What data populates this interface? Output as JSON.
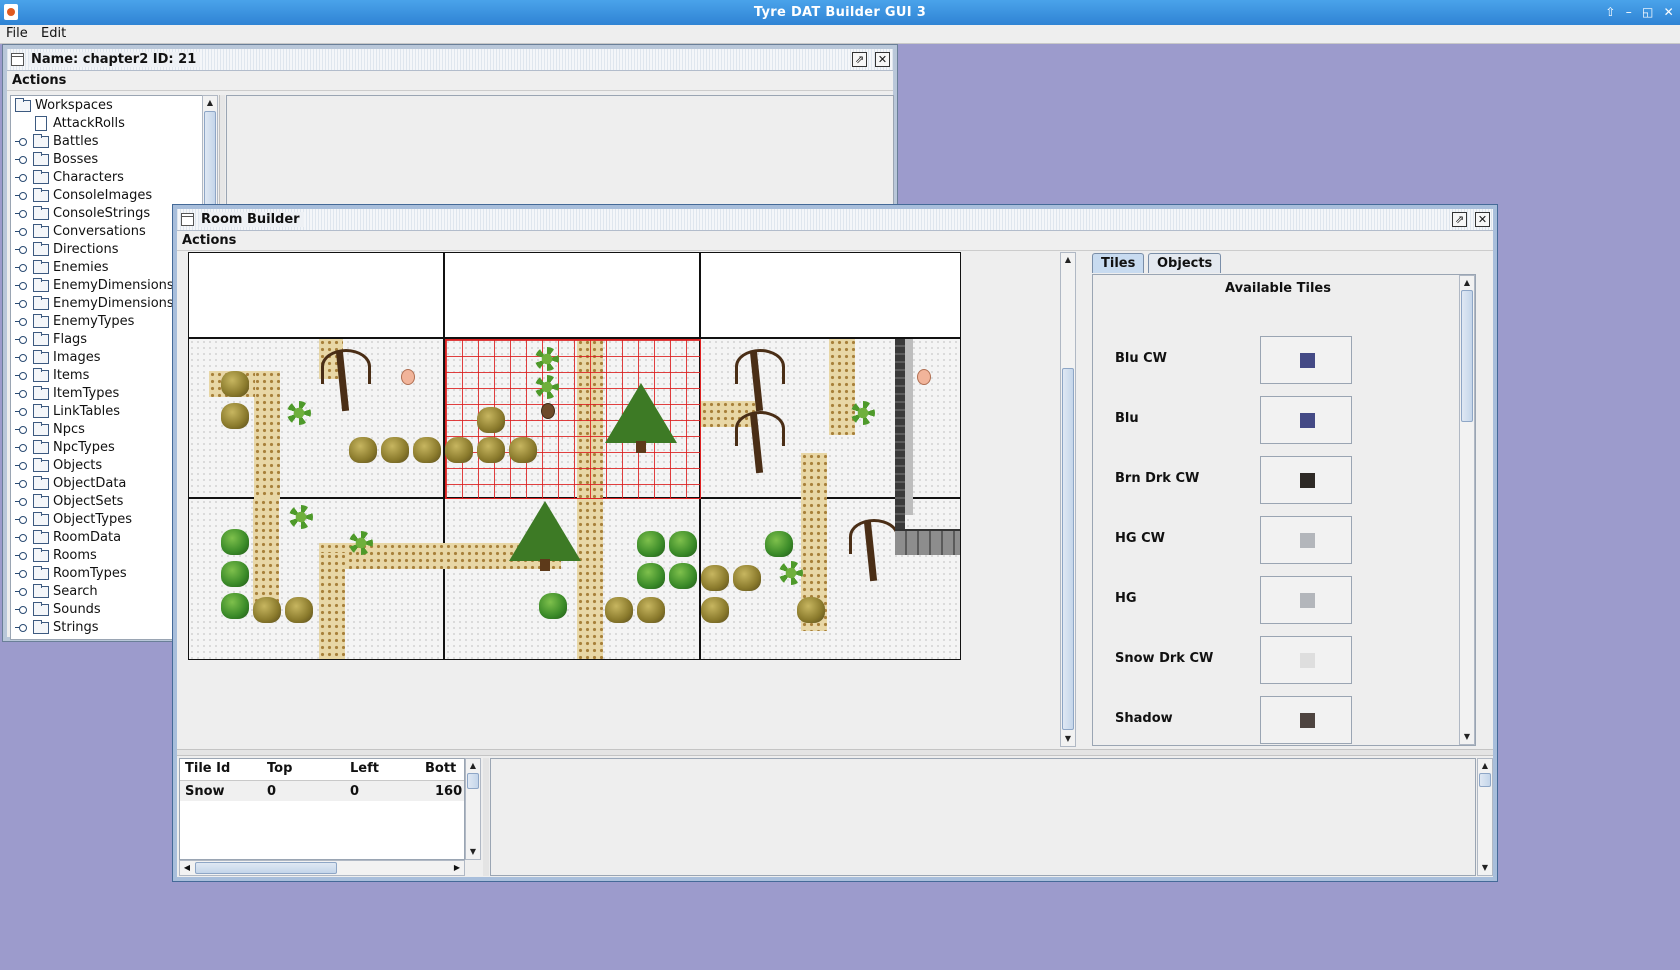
{
  "app": {
    "title": "Tyre DAT Builder GUI 3"
  },
  "window_controls": {
    "restore": "⇧",
    "minimize": "–",
    "maximize": "◱",
    "close": "✕"
  },
  "menu": {
    "file": "File",
    "edit": "Edit"
  },
  "explorer": {
    "title": "Name: chapter2 ID: 21",
    "actions": "Actions",
    "root": "Workspaces",
    "items": [
      "AttackRolls",
      "Battles",
      "Bosses",
      "Characters",
      "ConsoleImages",
      "ConsoleStrings",
      "Conversations",
      "Directions",
      "Enemies",
      "EnemyDimensions",
      "EnemyDimensionsD",
      "EnemyTypes",
      "Flags",
      "Images",
      "Items",
      "ItemTypes",
      "LinkTables",
      "Npcs",
      "NpcTypes",
      "Objects",
      "ObjectData",
      "ObjectSets",
      "ObjectTypes",
      "RoomData",
      "Rooms",
      "RoomTypes",
      "Search",
      "Sounds",
      "Strings"
    ]
  },
  "room_builder": {
    "title": "Room Builder",
    "actions": "Actions",
    "tabs": [
      "Tiles",
      "Objects"
    ],
    "selected_tab": "Tiles",
    "tiles_heading": "Available Tiles",
    "tiles": [
      {
        "name": "Blu CW",
        "color": "#444a85"
      },
      {
        "name": "Blu",
        "color": "#444a85"
      },
      {
        "name": "Brn Drk CW",
        "color": "#2e2a26"
      },
      {
        "name": "HG CW",
        "color": "#b3b6bb"
      },
      {
        "name": "HG",
        "color": "#b3b6bb"
      },
      {
        "name": "Snow Drk CW",
        "color": "#dedede"
      },
      {
        "name": "Shadow",
        "color": "#4e4440"
      }
    ],
    "table": {
      "headers": [
        "Tile Id",
        "Top",
        "Left",
        "Bott"
      ],
      "rows": [
        [
          "Snow",
          "0",
          "0",
          "160"
        ]
      ]
    }
  }
}
